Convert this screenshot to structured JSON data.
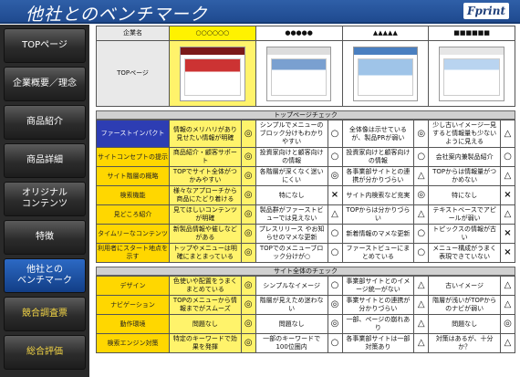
{
  "header": {
    "title": "他社とのベンチマーク",
    "logo": "Fprint"
  },
  "sidebar": {
    "items": [
      {
        "label": "TOPページ",
        "state": "normal"
      },
      {
        "label": "企業概要／理念",
        "state": "normal"
      },
      {
        "label": "商品紹介",
        "state": "normal"
      },
      {
        "label": "商品詳細",
        "state": "normal"
      },
      {
        "label": "オリジナル\nコンテンツ",
        "state": "normal"
      },
      {
        "label": "特徴",
        "state": "normal"
      },
      {
        "label": "他社との\nベンチマーク",
        "state": "active"
      },
      {
        "label": "競合調査票",
        "state": "yellow"
      },
      {
        "label": "総合評価",
        "state": "yellow"
      }
    ]
  },
  "table_header": {
    "col_label": "企業名",
    "companies": [
      "○○○○○○",
      "●●●●●",
      "▲▲▲▲▲",
      "■■■■■■"
    ],
    "thumbs_label": "TOPページ"
  },
  "section1": {
    "title": "トップページチェック",
    "rows": [
      {
        "label": "ファーストインパクト",
        "blue": true,
        "cells": [
          {
            "text": "情報のメリハリがあり見せたい情報が明確",
            "sym": "◎"
          },
          {
            "text": "シンプルでメニューのブロック分けもわかりやすい",
            "sym": "○"
          },
          {
            "text": "全体像は示せているが、製品PRが弱い",
            "sym": "◎"
          },
          {
            "text": "少し古いイメージ一見すると情報量も少ないように見える",
            "sym": "△"
          }
        ]
      },
      {
        "label": "サイトコンセプトの提示",
        "blue": false,
        "cells": [
          {
            "text": "商品紹介・顧客サポート",
            "sym": "◎"
          },
          {
            "text": "投資家向けと顧客向けの情報",
            "sym": "○"
          },
          {
            "text": "投資家向けと顧客向けの情報",
            "sym": "○"
          },
          {
            "text": "会社案内兼製品紹介",
            "sym": "○"
          }
        ]
      },
      {
        "label": "サイト階層の概略",
        "blue": false,
        "cells": [
          {
            "text": "TOPでサイト全体がつかみやすい",
            "sym": "◎"
          },
          {
            "text": "各階層が深くなく迷いにくい",
            "sym": "◎"
          },
          {
            "text": "各事業部サイトとの連携が分かりづらい",
            "sym": "△"
          },
          {
            "text": "TOPからは情報量がつかめない",
            "sym": "△"
          }
        ]
      },
      {
        "label": "検索機能",
        "blue": false,
        "cells": [
          {
            "text": "様々なアプローチから商品にたどり着ける",
            "sym": "◎"
          },
          {
            "text": "特になし",
            "sym": "×"
          },
          {
            "text": "サイト内検索など充実",
            "sym": "◎"
          },
          {
            "text": "特になし",
            "sym": "×"
          }
        ]
      },
      {
        "label": "見どころ紹介",
        "blue": false,
        "cells": [
          {
            "text": "見てほしいコンテンツが明確",
            "sym": "◎"
          },
          {
            "text": "製品群がファーストビューでは見えない",
            "sym": "△"
          },
          {
            "text": "TOPからは分かりづらい",
            "sym": "△"
          },
          {
            "text": "テキストベースでアピールが弱い",
            "sym": "△"
          }
        ]
      },
      {
        "label": "タイムリーなコンテンツ",
        "blue": false,
        "cells": [
          {
            "text": "新製品情報や催しなどがある",
            "sym": "◎"
          },
          {
            "text": "プレスリリース やお知らせのマメな更新",
            "sym": "○"
          },
          {
            "text": "新着情報のマメな更新",
            "sym": "○"
          },
          {
            "text": "トピックスの情報が古い",
            "sym": "×"
          }
        ]
      },
      {
        "label": "利用者にスタート地点を示す",
        "blue": false,
        "cells": [
          {
            "text": "トップやメニューは明確にまとまっている",
            "sym": "◎"
          },
          {
            "text": "TOPでのメニューブロック分けが○",
            "sym": "○"
          },
          {
            "text": "ファーストビューにまとめている",
            "sym": "○"
          },
          {
            "text": "メニュー構成がうまく表現できていない",
            "sym": "×"
          }
        ]
      }
    ]
  },
  "section2": {
    "title": "サイト全体のチェック",
    "rows": [
      {
        "label": "デザイン",
        "cells": [
          {
            "text": "色使いや配置をうまくまとめている",
            "sym": "◎"
          },
          {
            "text": "シンプルなイメージ",
            "sym": "○"
          },
          {
            "text": "事業部サイトとのイメージ統一がない",
            "sym": "△"
          },
          {
            "text": "古いイメージ",
            "sym": "△"
          }
        ]
      },
      {
        "label": "ナビゲーション",
        "cells": [
          {
            "text": "TOPのメニューから情報までがスムーズ",
            "sym": "◎"
          },
          {
            "text": "階層が見えため迷わない",
            "sym": "◎"
          },
          {
            "text": "事業サイトとの連携が分かりづらい",
            "sym": "△"
          },
          {
            "text": "階層が浅いがTOPからのナビが弱い",
            "sym": "△"
          }
        ]
      },
      {
        "label": "動作環境",
        "cells": [
          {
            "text": "問題なし",
            "sym": "◎"
          },
          {
            "text": "問題なし",
            "sym": "◎"
          },
          {
            "text": "一部、ページの崩れあり",
            "sym": "△"
          },
          {
            "text": "問題なし",
            "sym": "◎"
          }
        ]
      },
      {
        "label": "検索エンジン対策",
        "cells": [
          {
            "text": "特定のキーワードで効果を発揮",
            "sym": "◎"
          },
          {
            "text": "一部のキーワードで100位圏内",
            "sym": "○"
          },
          {
            "text": "各事業部サイトは一部対策あり",
            "sym": "△"
          },
          {
            "text": "対策はあるが、十分か？",
            "sym": "△"
          }
        ]
      }
    ]
  },
  "colors": {
    "header": "#2558a3",
    "selected_col": "#fff36b",
    "label_yellow": "#ffd700",
    "label_blue": "#2d3db3"
  }
}
